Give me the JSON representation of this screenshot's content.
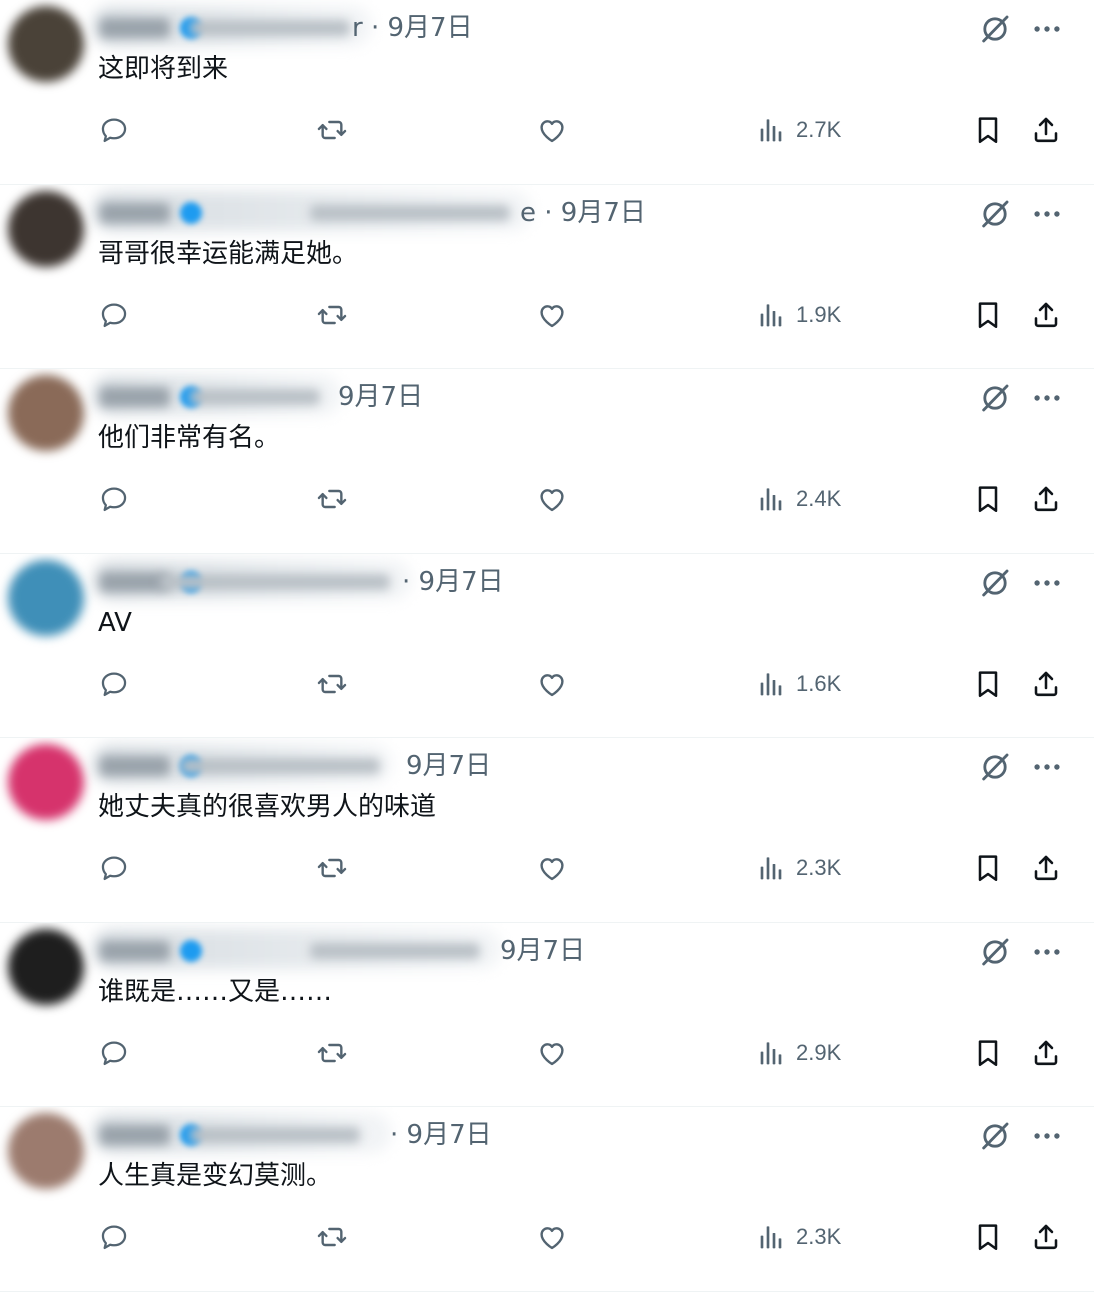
{
  "colors": {
    "text": "#0f1419",
    "secondary": "#536471",
    "divider": "#eff3f4",
    "verified": "#1d9bf0",
    "icon": "#536471"
  },
  "icons": {
    "reply": "speech-bubble-icon",
    "retweet": "retweet-icon",
    "like": "heart-icon",
    "views": "bar-chart-icon",
    "bookmark": "bookmark-icon",
    "share": "share-upload-icon",
    "grok": "slashed-circle-icon",
    "more": "ellipsis-icon"
  },
  "tweets": [
    {
      "meta_tail": "r · 9月7日",
      "text": "这即将到来",
      "views": "2.7K",
      "avatar_color": "#4a4238"
    },
    {
      "meta_tail": "e · 9月7日",
      "text": "哥哥很幸运能满足她。",
      "views": "1.9K",
      "avatar_color": "#3d3530"
    },
    {
      "meta_tail": "9月7日",
      "text": "他们非常有名。",
      "views": "2.4K",
      "avatar_color": "#8a6a58"
    },
    {
      "meta_tail": "· 9月7日",
      "text": "AV",
      "views": "1.6K",
      "avatar_color": "#3f8fb8"
    },
    {
      "meta_tail": "9月7日",
      "text": "她丈夫真的很喜欢男人的味道",
      "views": "2.3K",
      "avatar_color": "#d6336c"
    },
    {
      "meta_tail": "9月7日",
      "text": "谁既是……又是……",
      "views": "2.9K",
      "avatar_color": "#1e1e1e"
    },
    {
      "meta_tail": "· 9月7日",
      "text": "人生真是变幻莫测。",
      "views": "2.3K",
      "avatar_color": "#9c7b6e"
    }
  ]
}
